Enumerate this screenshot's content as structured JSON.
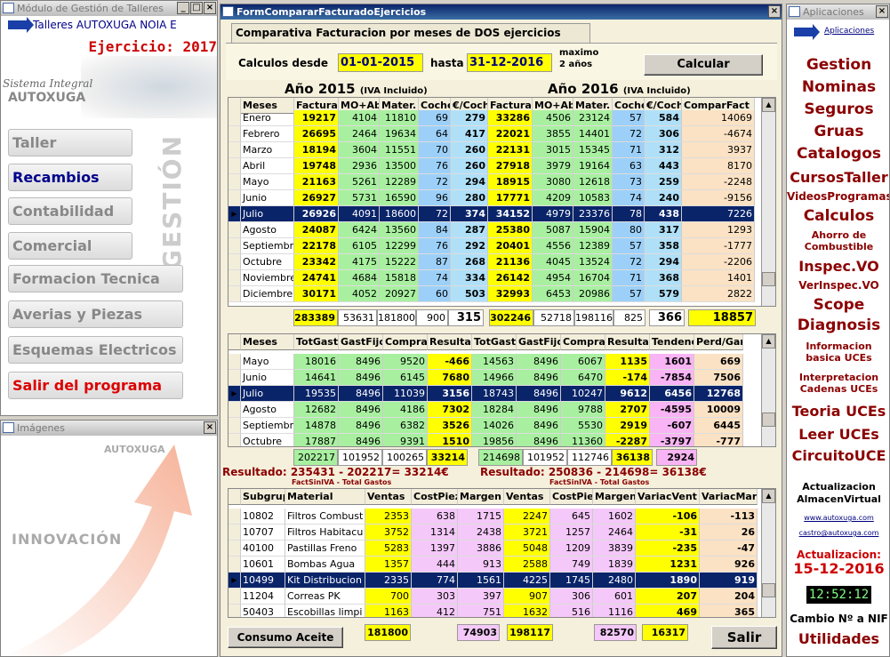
{
  "left_window": {
    "title": "Módulo de Gestión de Talleres",
    "brand": "Talleres AUTOXUGA NOIA E",
    "ejercicio": "Ejercicio: 2017",
    "sistema": "Sistema Integral",
    "autoxuga": "AUTOXUGA",
    "gestion_watermark": "GESTIÓN",
    "menu": [
      {
        "label": "Taller",
        "color": "#888888"
      },
      {
        "label": "Recambios",
        "color": "#00008b"
      },
      {
        "label": "Contabilidad",
        "color": "#888888"
      },
      {
        "label": "Comercial",
        "color": "#888888"
      },
      {
        "label": "Formacion Tecnica",
        "color": "#888888"
      },
      {
        "label": "Averias y Piezas",
        "color": "#888888"
      },
      {
        "label": "Esquemas Electricos",
        "color": "#888888"
      },
      {
        "label": "Salir del programa",
        "color": "#dd0000"
      }
    ]
  },
  "images_window": {
    "title": "Imágenes",
    "autoxuga": "AUTOXUGA",
    "innovacion": "INNOVACIÓN"
  },
  "form": {
    "title": "FormCompararFacturadoEjercicios",
    "tab": "Comparativa Facturacion por meses de DOS ejercicios",
    "desde_label": "Calculos desde",
    "desde_value": "01-01-2015",
    "hasta_label": "hasta",
    "hasta_value": "31-12-2016",
    "maximo": "maximo",
    "anos": "2 años",
    "calcular": "Calcular",
    "year1_title": "Año 2015",
    "year2_title": "Año 2016",
    "iva": "(IVA Incluido)",
    "grid1": {
      "headers": [
        "Meses",
        "Facturad",
        "MO+Ab",
        "Mater.",
        "Coche",
        "€/Coch",
        "Facturad",
        "MO+Ab",
        "Mater.",
        "Coche",
        "€/Coch",
        "ComparFact"
      ],
      "rows": [
        [
          "Enero",
          "19217",
          "4104",
          "11810",
          "69",
          "279",
          "33286",
          "4506",
          "23124",
          "57",
          "584",
          "14069"
        ],
        [
          "Febrero",
          "26695",
          "2464",
          "19634",
          "64",
          "417",
          "22021",
          "3855",
          "14401",
          "72",
          "306",
          "-4674"
        ],
        [
          "Marzo",
          "18194",
          "3604",
          "11551",
          "70",
          "260",
          "22131",
          "3015",
          "15345",
          "71",
          "312",
          "3937"
        ],
        [
          "Abril",
          "19748",
          "2936",
          "13500",
          "76",
          "260",
          "27918",
          "3979",
          "19164",
          "63",
          "443",
          "8170"
        ],
        [
          "Mayo",
          "21163",
          "5261",
          "12289",
          "72",
          "294",
          "18915",
          "3080",
          "12618",
          "73",
          "259",
          "-2248"
        ],
        [
          "Junio",
          "26927",
          "5731",
          "16590",
          "96",
          "280",
          "17771",
          "4209",
          "10583",
          "74",
          "240",
          "-9156"
        ],
        [
          "Julio",
          "26926",
          "4091",
          "18600",
          "72",
          "374",
          "34152",
          "4979",
          "23376",
          "78",
          "438",
          "7226"
        ],
        [
          "Agosto",
          "24087",
          "6424",
          "13560",
          "84",
          "287",
          "25380",
          "5087",
          "15904",
          "80",
          "317",
          "1293"
        ],
        [
          "Septiembr",
          "22178",
          "6105",
          "12299",
          "76",
          "292",
          "20401",
          "4556",
          "12389",
          "57",
          "358",
          "-1777"
        ],
        [
          "Octubre",
          "23342",
          "4175",
          "15222",
          "87",
          "268",
          "21136",
          "4045",
          "13524",
          "72",
          "294",
          "-2206"
        ],
        [
          "Noviembre",
          "24741",
          "4684",
          "15818",
          "74",
          "334",
          "26142",
          "4954",
          "16704",
          "71",
          "368",
          "1401"
        ],
        [
          "Diciembre",
          "30171",
          "4052",
          "20927",
          "60",
          "503",
          "32993",
          "6453",
          "20986",
          "57",
          "579",
          "2822"
        ]
      ],
      "selected": 6,
      "totals": [
        "283389",
        "53631",
        "181800",
        "900",
        "315",
        "302246",
        "52718",
        "198116",
        "825",
        "366",
        "18857"
      ]
    },
    "grid2": {
      "headers": [
        "Meses",
        "TotGasto",
        "GastFijo",
        "Compra",
        "Resultad",
        "TotGasto",
        "GastFijo",
        "Compra",
        "Resultad",
        "Tendenc",
        "Perd/Gan"
      ],
      "rows": [
        [
          "Mayo",
          "18016",
          "8496",
          "9520",
          "-466",
          "14563",
          "8496",
          "6067",
          "1135",
          "1601",
          "669"
        ],
        [
          "Junio",
          "14641",
          "8496",
          "6145",
          "7680",
          "14966",
          "8496",
          "6470",
          "-174",
          "-7854",
          "7506"
        ],
        [
          "Julio",
          "19535",
          "8496",
          "11039",
          "3156",
          "18743",
          "8496",
          "10247",
          "9612",
          "6456",
          "12768"
        ],
        [
          "Agosto",
          "12682",
          "8496",
          "4186",
          "7302",
          "18284",
          "8496",
          "9788",
          "2707",
          "-4595",
          "10009"
        ],
        [
          "Septiembr",
          "14878",
          "8496",
          "6382",
          "3526",
          "14026",
          "8496",
          "5530",
          "2919",
          "-607",
          "6445"
        ],
        [
          "Octubre",
          "17887",
          "8496",
          "9391",
          "1510",
          "19856",
          "8496",
          "11360",
          "-2287",
          "-3797",
          "-777"
        ]
      ],
      "selected": 2,
      "totals": [
        "202217",
        "101952",
        "100265",
        "33214",
        "214698",
        "101952",
        "112746",
        "36138",
        "2924"
      ]
    },
    "resultado1": "Resultado: 235431 - 202217= 33214€",
    "resultado2": "Resultado: 250836 - 214698= 36138€",
    "fact_sin_iva": "FactSinIVA - Total Gastos",
    "grid3": {
      "headers": [
        "Subgrup",
        "Material",
        "Ventas",
        "CostPiez",
        "Margen",
        "Ventas",
        "CostPiez",
        "Margen",
        "VariacVent",
        "VariacMarg"
      ],
      "rows": [
        [
          "10802",
          "Filtros Combust",
          "2353",
          "638",
          "1715",
          "2247",
          "645",
          "1602",
          "-106",
          "-113"
        ],
        [
          "10707",
          "Filtros Habitacu",
          "3752",
          "1314",
          "2438",
          "3721",
          "1257",
          "2464",
          "-31",
          "26"
        ],
        [
          "40100",
          "Pastillas Freno",
          "5283",
          "1397",
          "3886",
          "5048",
          "1209",
          "3839",
          "-235",
          "-47"
        ],
        [
          "10601",
          "Bombas Agua",
          "1357",
          "444",
          "913",
          "2588",
          "749",
          "1839",
          "1231",
          "926"
        ],
        [
          "10499",
          "Kit Distribucion",
          "2335",
          "774",
          "1561",
          "4225",
          "1745",
          "2480",
          "1890",
          "919"
        ],
        [
          "11204",
          "Correas PK",
          "700",
          "303",
          "397",
          "907",
          "306",
          "601",
          "207",
          "204"
        ],
        [
          "50403",
          "Escobillas limpi",
          "1163",
          "412",
          "751",
          "1632",
          "516",
          "1116",
          "469",
          "365"
        ]
      ],
      "selected": 4,
      "totals": [
        "181800",
        "74903",
        "198117",
        "82570",
        "16317"
      ]
    },
    "consumo_aceite": "Consumo Aceite",
    "salir": "Salir"
  },
  "right_window": {
    "title": "Aplicaciones",
    "aplicaciones": "Aplicaciones",
    "items": [
      {
        "label": "Gestion",
        "size": 17
      },
      {
        "label": "Nominas",
        "size": 17
      },
      {
        "label": "Seguros",
        "size": 17
      },
      {
        "label": "Gruas",
        "size": 17
      },
      {
        "label": "Catalogos",
        "size": 17
      },
      {
        "label": "CursosTaller",
        "size": 16
      },
      {
        "label": "VideosProgramas",
        "size": 12
      },
      {
        "label": "Calculos",
        "size": 17
      },
      {
        "label": "Ahorro de",
        "size": 11
      },
      {
        "label": "Combustible",
        "size": 11
      },
      {
        "label": "Inspec.VO",
        "size": 16
      },
      {
        "label": "VerInspec.VO",
        "size": 12
      },
      {
        "label": "Scope",
        "size": 17
      },
      {
        "label": "Diagnosis",
        "size": 17
      },
      {
        "label": "Informacion",
        "size": 11
      },
      {
        "label": "basica UCEs",
        "size": 11
      },
      {
        "label": "Interpretacion",
        "size": 11
      },
      {
        "label": "Cadenas UCEs",
        "size": 11
      },
      {
        "label": "Teoria UCEs",
        "size": 16
      },
      {
        "label": "Leer UCEs",
        "size": 16
      },
      {
        "label": "CircuitoUCE",
        "size": 16
      }
    ],
    "actualizacion": "Actualizacion",
    "almacen": "AlmacenVirtual",
    "web": "www.autoxuga.com",
    "email": "castro@autoxuga.com",
    "act_label": "Actualizacion:",
    "act_date": "15-12-2016",
    "clock": "12:52:12",
    "cambio": "Cambio Nº a NIF",
    "utilidades": "Utilidades"
  }
}
